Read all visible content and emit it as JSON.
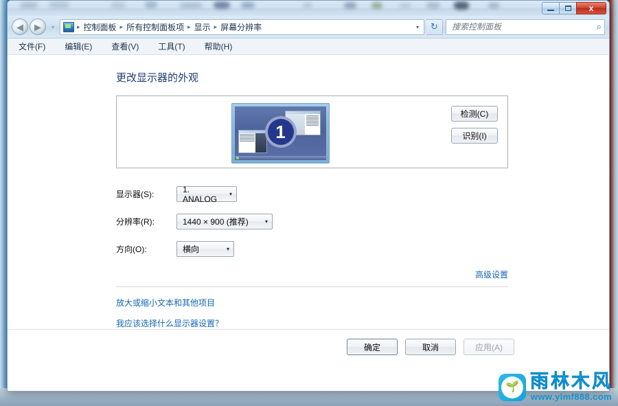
{
  "window": {
    "controls": {
      "minimize": "–",
      "maximize": "□",
      "close": "x"
    }
  },
  "nav": {
    "back_icon": "◀",
    "forward_icon": "▶",
    "history_chevron": "▾",
    "address_dropdown": "▾",
    "refresh_icon": "↻",
    "breadcrumbs": [
      "控制面板",
      "所有控制面板项",
      "显示",
      "屏幕分辨率"
    ],
    "separator": "▸"
  },
  "search": {
    "placeholder": "搜索控制面板",
    "value": "",
    "icon": "⌕"
  },
  "menubar": {
    "items": [
      "文件(F)",
      "编辑(E)",
      "查看(V)",
      "工具(T)",
      "帮助(H)"
    ]
  },
  "main": {
    "page_title": "更改显示器的外观",
    "preview": {
      "monitor_number": "1",
      "detect_button": "检测(C)",
      "identify_button": "识别(I)"
    },
    "fields": [
      {
        "label": "显示器(S):",
        "value": "1. ANALOG",
        "arrow": "▾"
      },
      {
        "label": "分辨率(R):",
        "value": "1440 × 900 (推荐)",
        "arrow": "▾"
      },
      {
        "label": "方向(O):",
        "value": "横向",
        "arrow": "▾"
      }
    ],
    "advanced_link": "高级设置",
    "links": [
      "放大或缩小文本和其他项目",
      "我应该选择什么显示器设置？"
    ]
  },
  "dialog_buttons": {
    "ok": "确定",
    "cancel": "取消",
    "apply": "应用(A)",
    "apply_disabled": true
  },
  "watermark": {
    "brand": "雨林木风",
    "url": "www.ylmf888.com",
    "logo_glyph": "🌱"
  },
  "colors": {
    "accent_link": "#1667b3",
    "title_blue": "#1d3f73",
    "close_red": "#b72f1c",
    "watermark_blue": "#19a8e0"
  }
}
